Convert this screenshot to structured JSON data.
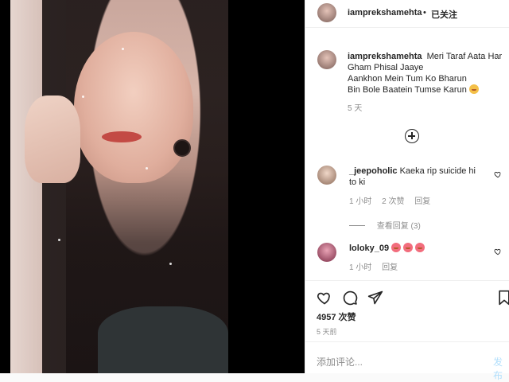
{
  "post": {
    "username": "iamprekshamehta",
    "separator": "•",
    "follow_label": "已关注"
  },
  "caption": {
    "username": "iamprekshamehta",
    "lines": [
      "Meri Taraf Aata Har Gham Phisal Jaaye",
      "Aankhon Mein Tum Ko Bharun",
      "Bin Bole Baatein Tumse Karun"
    ],
    "emoji": "smiling-face-hearts-emoji",
    "time": "5 天"
  },
  "comments": [
    {
      "username": "_jeepoholic",
      "text": "Kaeka rip suicide hi to ki",
      "time": "1 小时",
      "likes": "2 次赞",
      "reply": "回复"
    },
    {
      "username": "loloky_09",
      "emoji": "heart-eyes-emoji",
      "time": "1 小时",
      "reply": "回复"
    }
  ],
  "view_replies": "查看回复 (3)",
  "likes_count": "4957 次赞",
  "post_date": "5 天前",
  "add_comment_placeholder": "添加评论...",
  "post_button": "发布",
  "colors": {
    "accent": "#262626",
    "muted": "#8e8e8e",
    "post_disabled": "#b2dffc"
  }
}
